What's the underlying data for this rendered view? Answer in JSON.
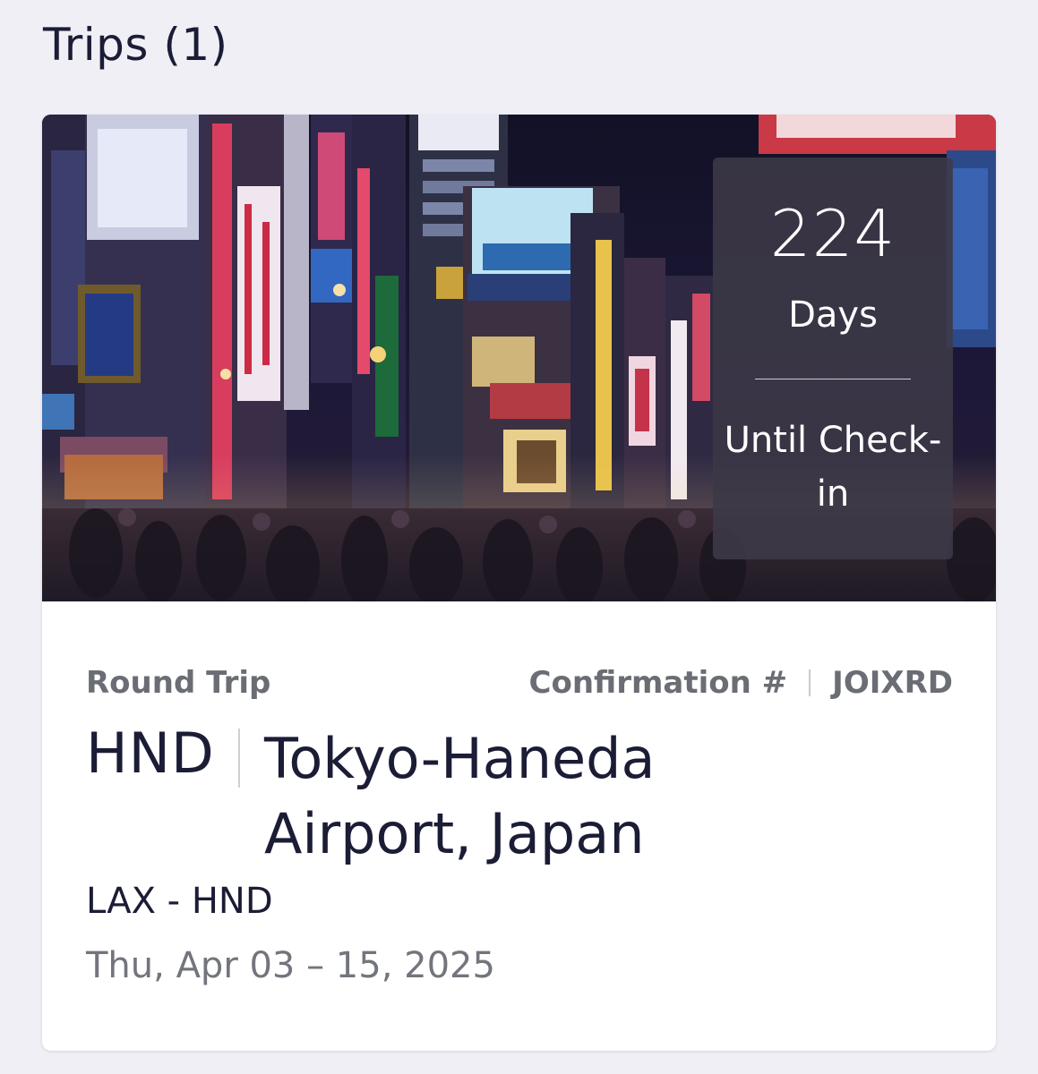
{
  "header": {
    "title": "Trips (1)"
  },
  "trip": {
    "image_alt": "Tokyo night street scene",
    "countdown": {
      "number": "224",
      "unit": "Days",
      "caption": "Until Check-in"
    },
    "trip_type": "Round Trip",
    "confirmation_label": "Confirmation #",
    "confirmation_code": "JOIXRD",
    "destination_code": "HND",
    "destination_name": "Tokyo-Haneda Airport, Japan",
    "route": "LAX - HND",
    "dates": "Thu, Apr 03 – 15, 2025"
  }
}
